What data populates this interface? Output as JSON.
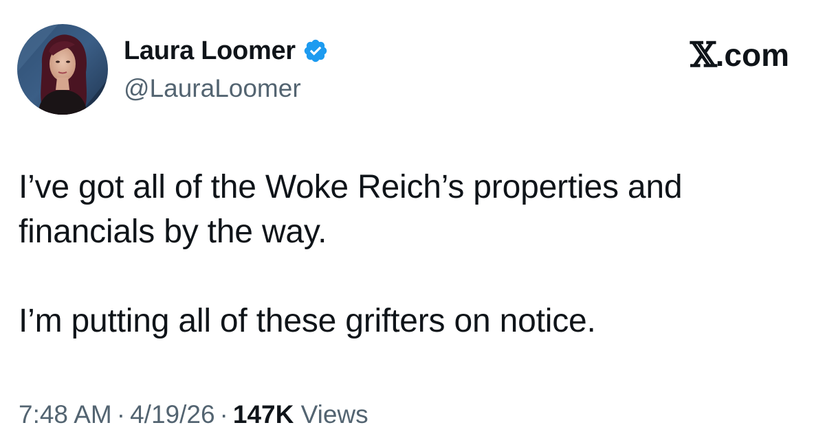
{
  "author": {
    "name": "Laura Loomer",
    "handle": "@LauraLoomer",
    "verified_color": "#1d9bf0"
  },
  "brand": {
    "mark": "𝕏",
    "tld": ".com"
  },
  "tweet": {
    "paragraphs": [
      "I’ve got all of the Woke Reich’s properties and financials by the way.",
      "I’m putting all of these grifters on notice."
    ]
  },
  "meta": {
    "time": "7:48 AM",
    "date": "4/19/26",
    "separator": "·",
    "views_count": "147K",
    "views_label": "Views"
  },
  "icons": {
    "avatar": "profile-photo",
    "verified": "verified-badge-icon"
  },
  "colors": {
    "text": "#0f1419",
    "secondary": "#536471",
    "verified": "#1d9bf0",
    "background": "#ffffff"
  }
}
